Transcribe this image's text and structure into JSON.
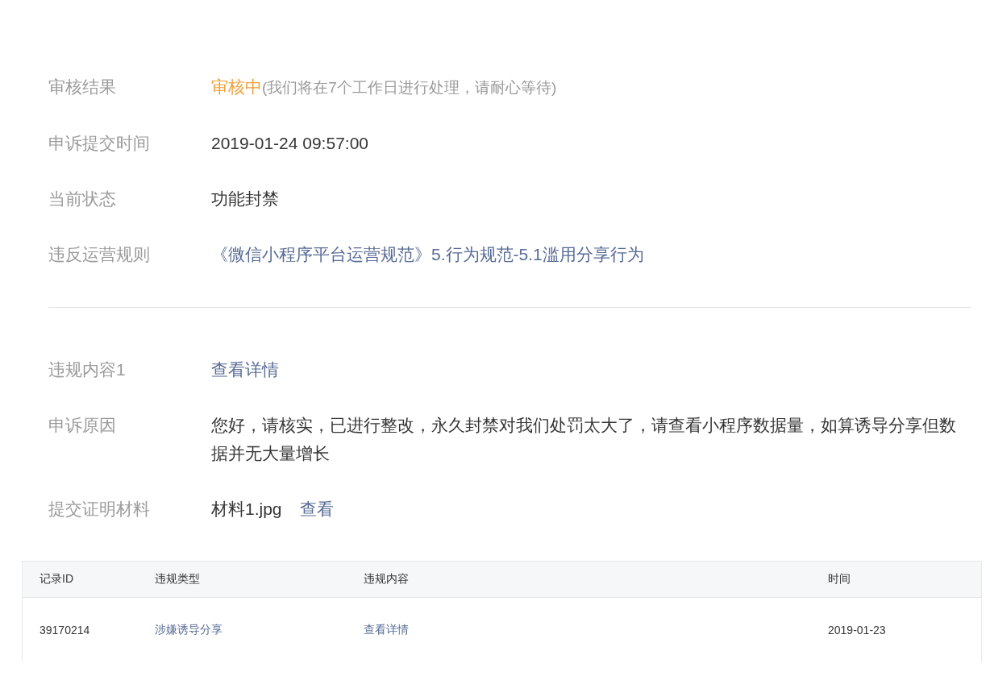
{
  "groups": [
    {
      "fields": [
        {
          "kind": "status",
          "label": "审核结果",
          "status": "审核中",
          "note": "(我们将在7个工作日进行处理，请耐心等待)"
        },
        {
          "kind": "text",
          "label": "申诉提交时间",
          "value": "2019-01-24 09:57:00"
        },
        {
          "kind": "text",
          "label": "当前状态",
          "value": "功能封禁"
        },
        {
          "kind": "link",
          "label": "违反运营规则",
          "value": "《微信小程序平台运营规范》5.行为规范-5.1滥用分享行为"
        }
      ]
    },
    {
      "fields": [
        {
          "kind": "link",
          "label": "违规内容1",
          "value": "查看详情"
        },
        {
          "kind": "text",
          "label": "申诉原因",
          "value": "您好，请核实，已进行整改，永久封禁对我们处罚太大了，请查看小程序数据量，如算诱导分享但数据并无大量增长"
        },
        {
          "kind": "file",
          "label": "提交证明材料",
          "value": "材料1.jpg",
          "action": "查看"
        }
      ]
    }
  ],
  "table": {
    "columns": [
      "记录ID",
      "违规类型",
      "违规内容",
      "时间"
    ],
    "rows": [
      {
        "cells": [
          {
            "kind": "text",
            "text": "39170214"
          },
          {
            "kind": "link",
            "text": "涉嫌诱导分享"
          },
          {
            "kind": "link",
            "text": "查看详情"
          },
          {
            "kind": "text",
            "text": "2019-01-23"
          }
        ]
      }
    ]
  }
}
